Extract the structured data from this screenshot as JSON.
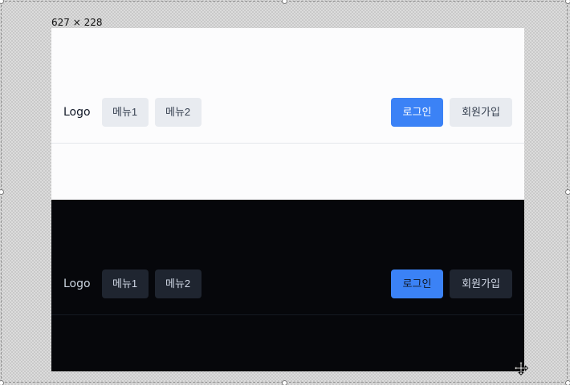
{
  "canvas": {
    "size_label": "627 × 228"
  },
  "themes": [
    {
      "name": "light",
      "navbar": {
        "logo": "Logo",
        "menu_items": [
          "메뉴1",
          "메뉴2"
        ],
        "login_label": "로그인",
        "signup_label": "회원가입"
      }
    },
    {
      "name": "dark",
      "navbar": {
        "logo": "Logo",
        "menu_items": [
          "메뉴1",
          "메뉴2"
        ],
        "login_label": "로그인",
        "signup_label": "회원가입"
      }
    }
  ],
  "icons": {
    "selection_handles": "selection-handle-icon",
    "move_cursor": "move-cursor-icon"
  },
  "colors": {
    "light_background": "#fcfcfd",
    "dark_background": "#06070b",
    "primary_blue": "#3b82f6",
    "light_secondary_button": "#e8ebf0",
    "dark_secondary_button": "#1f2530"
  }
}
